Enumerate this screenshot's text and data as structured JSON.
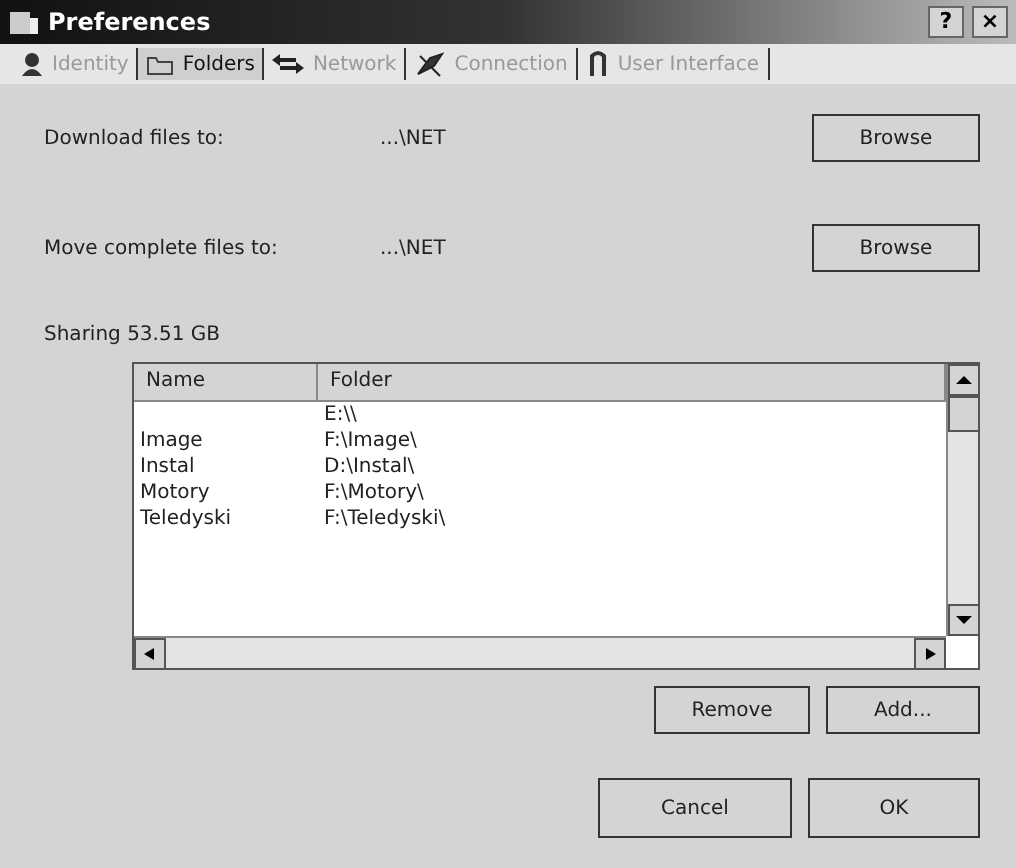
{
  "window": {
    "title": "Preferences",
    "help": "?",
    "close": "×"
  },
  "tabs": [
    {
      "label": "Identity",
      "selected": false
    },
    {
      "label": "Folders",
      "selected": true
    },
    {
      "label": "Network",
      "selected": false
    },
    {
      "label": "Connection",
      "selected": false
    },
    {
      "label": "User Interface",
      "selected": false
    }
  ],
  "paths": [
    {
      "label": "Download files to:",
      "value": "...\\NET",
      "button": "Browse"
    },
    {
      "label": "Move complete files to:",
      "value": "...\\NET",
      "button": "Browse"
    }
  ],
  "sharing": "Sharing 53.51 GB",
  "table": {
    "columns": [
      "Name",
      "Folder"
    ],
    "rows": [
      {
        "name": "",
        "folder": "E:\\\\"
      },
      {
        "name": "Image",
        "folder": "F:\\Image\\"
      },
      {
        "name": "Instal",
        "folder": "D:\\Instal\\"
      },
      {
        "name": "Motory",
        "folder": "F:\\Motory\\"
      },
      {
        "name": "Teledyski",
        "folder": "F:\\Teledyski\\"
      }
    ]
  },
  "list_buttons": [
    "Remove",
    "Add..."
  ],
  "dialog_buttons": [
    "Cancel",
    "OK"
  ]
}
